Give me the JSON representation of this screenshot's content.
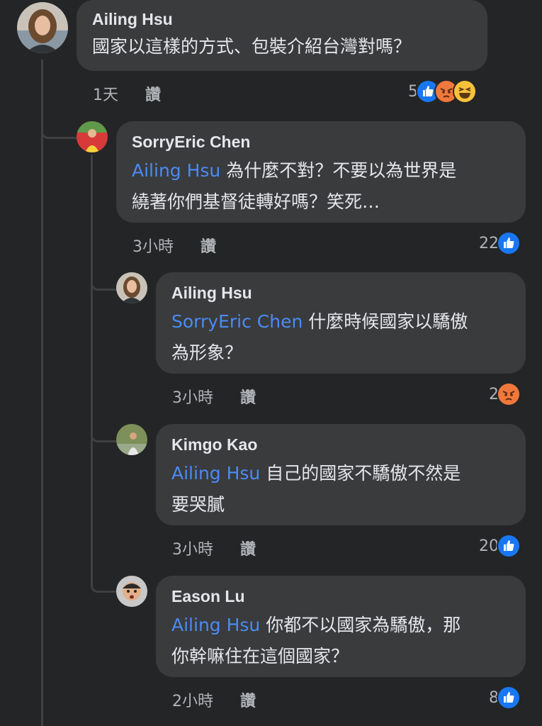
{
  "comments": [
    {
      "author": "Ailing Hsu",
      "mention": "",
      "text": "國家以這樣的方式、包裝介紹台灣對嗎？",
      "time": "1天",
      "like_label": "讚",
      "reaction_count": "5",
      "reactions": [
        "like-icon",
        "angry-icon",
        "haha-icon"
      ]
    },
    {
      "author": "SorryEric Chen",
      "mention": "Ailing Hsu",
      "text_line1": " 為什麼不對？不要以為世界是",
      "text_line2": "繞著你們基督徒轉好嗎？笑死…",
      "time": "3小時",
      "like_label": "讚",
      "reaction_count": "22",
      "reactions": [
        "like-icon"
      ]
    },
    {
      "author": "Ailing Hsu",
      "mention": "SorryEric Chen",
      "text_line1": " 什麼時候國家以驕傲",
      "text_line2": "為形象？",
      "time": "3小時",
      "like_label": "讚",
      "reaction_count": "2",
      "reactions": [
        "angry-icon"
      ]
    },
    {
      "author": "Kimgo Kao",
      "mention": "Ailing Hsu",
      "text_line1": " 自己的國家不驕傲不然是",
      "text_line2": "要哭膩",
      "time": "3小時",
      "like_label": "讚",
      "reaction_count": "20",
      "reactions": [
        "like-icon"
      ]
    },
    {
      "author": "Eason Lu",
      "mention": "Ailing Hsu",
      "text_line1": " 你都不以國家為驕傲，那",
      "text_line2": "你幹嘛住在這個國家？",
      "time": "2小時",
      "like_label": "讚",
      "reaction_count": "8",
      "reactions": [
        "like-icon"
      ]
    }
  ],
  "colors": {
    "background": "#242526",
    "bubble": "#3a3b3c",
    "mention": "#4b8bf5",
    "like": "#1877f2",
    "angry": "#f0783c"
  }
}
